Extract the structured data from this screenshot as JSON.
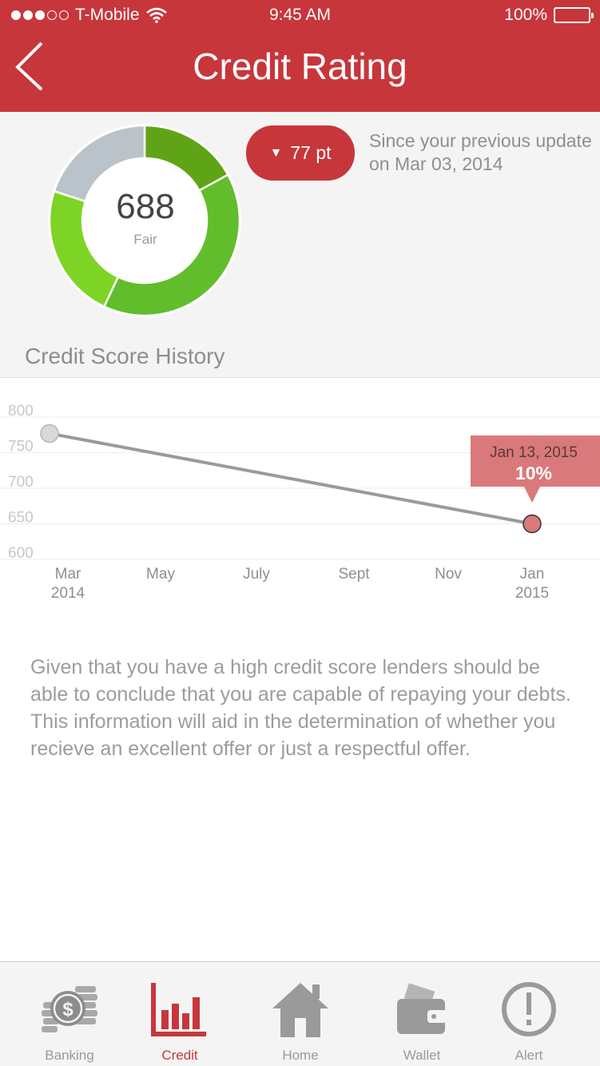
{
  "status_bar": {
    "carrier": "T-Mobile",
    "time": "9:45 AM",
    "battery": "100%"
  },
  "header": {
    "title": "Credit Rating",
    "back_icon": "chevron-left-icon"
  },
  "score": {
    "value": "688",
    "rating": "Fair",
    "change": "77 pt",
    "change_direction": "down",
    "since_text": "Since your previous update on Mar 03, 2014"
  },
  "gauge": {
    "segments": [
      {
        "fraction": 0.17,
        "color": "#5fa416"
      },
      {
        "fraction": 0.4,
        "color": "#62bd2c"
      },
      {
        "fraction": 0.23,
        "color": "#7dd424"
      },
      {
        "fraction": 0.2,
        "color": "#bac3c9"
      }
    ]
  },
  "history": {
    "title": "Credit Score History"
  },
  "chart_data": {
    "type": "line",
    "yticks": [
      "800",
      "750",
      "700",
      "650",
      "600"
    ],
    "xticks": [
      {
        "top": "Mar",
        "bottom": "2014"
      },
      {
        "top": "May",
        "bottom": ""
      },
      {
        "top": "July",
        "bottom": ""
      },
      {
        "top": "Sept",
        "bottom": ""
      },
      {
        "top": "Nov",
        "bottom": ""
      },
      {
        "top": "Jan",
        "bottom": "2015"
      }
    ],
    "ylim": [
      600,
      800
    ],
    "grid": true,
    "series": [
      {
        "points": [
          {
            "x": "Mar 2014",
            "y": 777
          },
          {
            "x": "Jan 2015",
            "y": 650
          }
        ]
      }
    ],
    "tooltip": {
      "date": "Jan 13, 2015",
      "value": "10%"
    },
    "colors": {
      "line": "#9a9a9a",
      "start_point": "#d9d9d9",
      "end_point": "#d9797b",
      "tooltip": "#d9797b"
    }
  },
  "description": "Given that you have a high credit score lenders should be able to conclude that you are capable of repaying your debts. This information will aid in the determination of whether you recieve an excellent offer or just a respectful offer.",
  "tabs": [
    {
      "label": "Banking",
      "icon": "coins-icon"
    },
    {
      "label": "Credit",
      "icon": "bar-chart-icon",
      "active": true
    },
    {
      "label": "Home",
      "icon": "home-icon"
    },
    {
      "label": "Wallet",
      "icon": "wallet-icon"
    },
    {
      "label": "Alert",
      "icon": "alert-icon"
    }
  ],
  "colors": {
    "brand": "#c7363b",
    "panel": "#f4f4f4"
  }
}
